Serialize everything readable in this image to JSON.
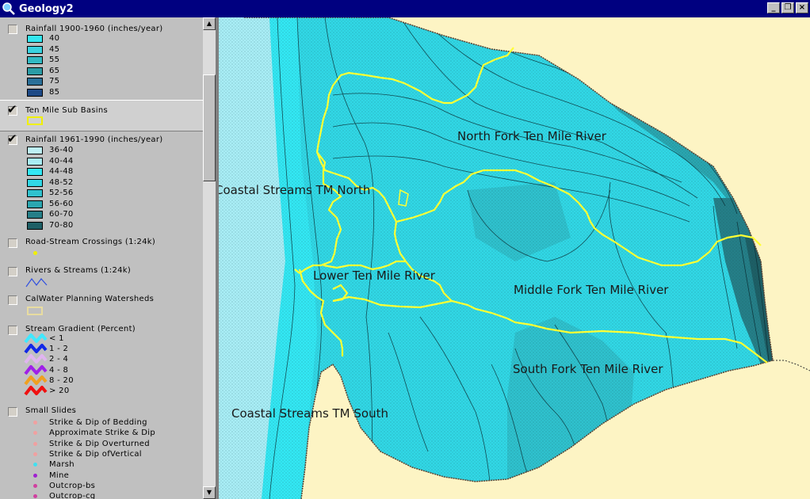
{
  "window": {
    "title": "Geology2"
  },
  "toc": {
    "rain1900": {
      "name": "Rainfall 1900-1960 (inches/year)",
      "classes": [
        "40",
        "45",
        "55",
        "65",
        "75",
        "85"
      ],
      "colors": [
        "#33e6f0",
        "#3ad3e0",
        "#32bac4",
        "#2b9ca6",
        "#2a6f98",
        "#1e4a86"
      ]
    },
    "subbasins": {
      "name": "Ten Mile Sub Basins"
    },
    "rain1961": {
      "name": "Rainfall 1961-1990 (inches/year)",
      "classes": [
        "36-40",
        "40-44",
        "44-48",
        "48-52",
        "52-56",
        "56-60",
        "60-70",
        "70-80"
      ],
      "colors": [
        "#bdf1f6",
        "#a9eef6",
        "#33e8f4",
        "#31d8e6",
        "#2fc2ce",
        "#2aa6b0",
        "#257f88",
        "#1e5f66"
      ]
    },
    "crossings": {
      "name": "Road-Stream Crossings (1:24k)"
    },
    "rivers": {
      "name": "Rivers & Streams (1:24k)"
    },
    "calwater": {
      "name": "CalWater Planning Watersheds"
    },
    "gradient": {
      "name": "Stream Gradient (Percent)",
      "classes": [
        "< 1",
        "1 - 2",
        "2 - 4",
        "4 - 8",
        "8 - 20",
        "> 20"
      ],
      "colors": [
        "#40e8ff",
        "#1228e8",
        "#e0b4f0",
        "#a020e8",
        "#f0a020",
        "#f01010"
      ]
    },
    "slides": {
      "name": "Small Slides",
      "items": [
        "Strike & Dip of Bedding",
        "Approximate Strike & Dip",
        "Strike & Dip Overturned",
        "Strike & Dip ofVertical",
        "Marsh",
        "Mine",
        "Outcrop-bs",
        "Outcrop-cg"
      ],
      "colors": [
        "#f0a0a0",
        "#f0a0a0",
        "#f0a0a0",
        "#f0a0a0",
        "#40e0f0",
        "#a020d0",
        "#d040a0",
        "#d040a0"
      ]
    }
  },
  "map": {
    "labels": {
      "north_fork": "North Fork Ten Mile River",
      "coastal_north": "Coastal Streams TM North",
      "lower": "Lower Ten Mile River",
      "middle": "Middle Fork Ten Mile River",
      "south_fork": "South Fork Ten Mile River",
      "coastal_south": "Coastal Streams TM South"
    },
    "colors": {
      "land": "#fdf4c4",
      "ocean": "#a8dcf4",
      "boundary": "#ffff33"
    }
  }
}
